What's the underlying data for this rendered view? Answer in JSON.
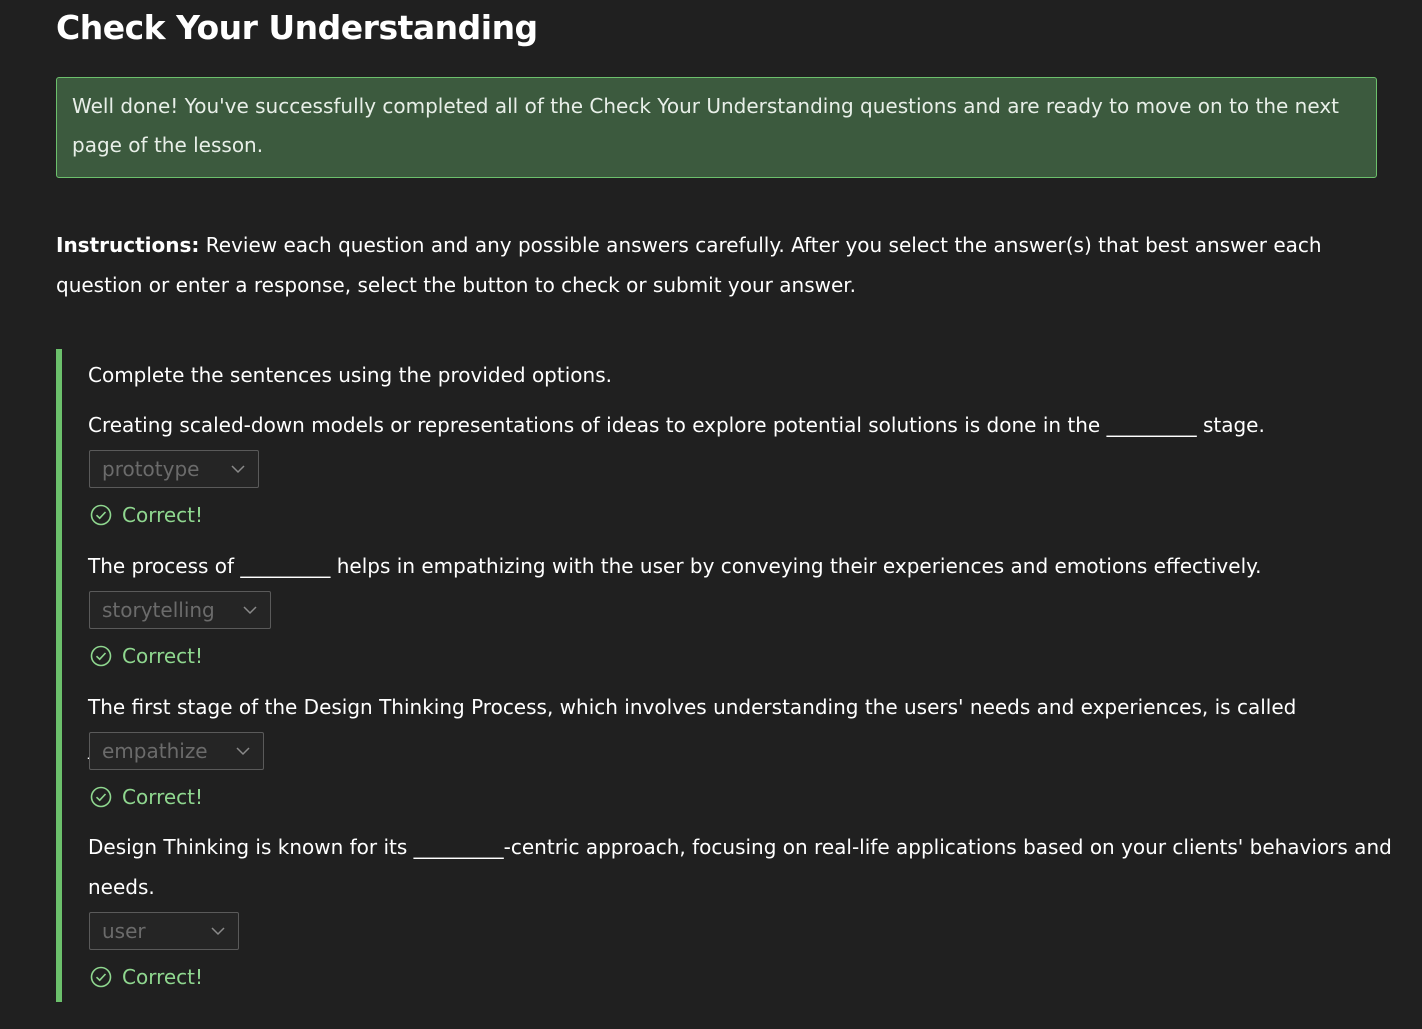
{
  "page": {
    "title": "Check Your Understanding"
  },
  "banner": {
    "message": "Well done! You've successfully completed all of the Check Your Understanding questions and are ready to move on to the next page of the lesson."
  },
  "instructions": {
    "label": "Instructions:",
    "text": " Review each question and any possible answers carefully. After you select the answer(s) that best answer each question or enter a response, select the button to check or submit your answer."
  },
  "quiz": {
    "prompt": "Complete the sentences using the provided options.",
    "questions": [
      {
        "text": "Creating scaled-down models or representations of ideas to explore potential solutions is done in the _________ stage.",
        "selected": "prototype",
        "feedback": "Correct!"
      },
      {
        "text": "The process of _________ helps in empathizing with the user by conveying their experiences and emotions effectively.",
        "selected": "storytelling",
        "feedback": "Correct!"
      },
      {
        "text": "The first stage of the Design Thinking Process, which involves understanding the users' needs and experiences, is called _________.",
        "selected": "empathize",
        "feedback": "Correct!"
      },
      {
        "text": "Design Thinking is known for its _________-centric approach, focusing on real-life applications based on your clients' behaviors and needs.",
        "selected": "user",
        "feedback": "Correct!"
      }
    ]
  },
  "colors": {
    "background": "#202020",
    "accent_green": "#6cc06c",
    "banner_bg": "#3c5a3e",
    "feedback_green": "#8fd78f"
  },
  "icons": {
    "dropdown": "chevron-down-icon",
    "feedback": "check-circle-icon"
  }
}
